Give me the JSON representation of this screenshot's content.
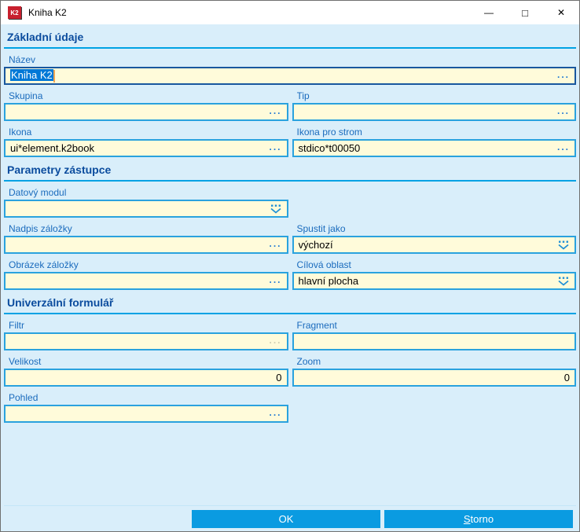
{
  "window": {
    "title": "Kniha K2",
    "icon_label": "K2",
    "controls": {
      "minimize": "—",
      "maximize": "□",
      "close": "✕"
    }
  },
  "sections": {
    "basic": "Základní údaje",
    "shortcut": "Parametry zástupce",
    "universal": "Univerzální formulář"
  },
  "fields": {
    "nazev": {
      "label": "Název",
      "value": "Kniha K2"
    },
    "skupina": {
      "label": "Skupina",
      "value": ""
    },
    "tip": {
      "label": "Tip",
      "value": ""
    },
    "ikona": {
      "label": "Ikona",
      "value": "ui*element.k2book"
    },
    "ikona_pro_strom": {
      "label": "Ikona pro strom",
      "value": "stdico*t00050"
    },
    "datovy_modul": {
      "label": "Datový modul",
      "value": ""
    },
    "nadpis_zalozky": {
      "label": "Nadpis záložky",
      "value": ""
    },
    "spustit_jako": {
      "label": "Spustit jako",
      "value": "výchozí"
    },
    "obrazek_zalozky": {
      "label": "Obrázek záložky",
      "value": ""
    },
    "cilova_oblast": {
      "label": "Cílová oblast",
      "value": "hlavní plocha"
    },
    "filtr": {
      "label": "Filtr",
      "value": ""
    },
    "fragment": {
      "label": "Fragment",
      "value": ""
    },
    "velikost": {
      "label": "Velikost",
      "value": "0"
    },
    "zoom": {
      "label": "Zoom",
      "value": "0"
    },
    "pohled": {
      "label": "Pohled",
      "value": ""
    }
  },
  "icons": {
    "ellipsis": "..."
  },
  "buttons": {
    "ok": "OK",
    "storno": "Storno"
  },
  "colors": {
    "background": "#D9EEFA",
    "titlebar": "#FFFFFF",
    "field_bg": "#FFFBDA",
    "field_border": "#2AA2DE",
    "focus_border": "#19579E",
    "section_title": "#0B4C9E",
    "section_line": "#00A2E4",
    "label": "#1A6BBD",
    "selection": "#0078D7",
    "button": "#0A9BE1",
    "caret": "#F2A654",
    "app_icon": "#C8202E"
  }
}
